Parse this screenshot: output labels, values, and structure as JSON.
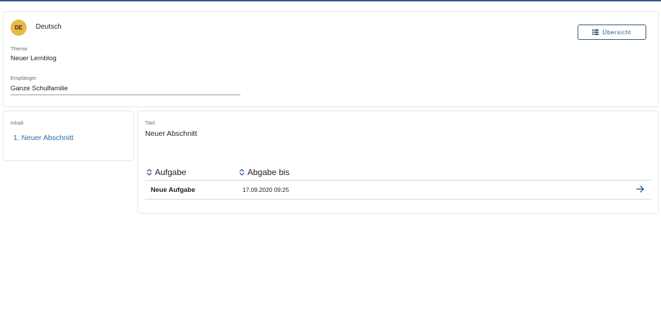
{
  "language": {
    "code": "DE",
    "name": "Deutsch"
  },
  "header_button": {
    "label": "Übersicht",
    "icon": "list-icon"
  },
  "topic": {
    "label": "Thema",
    "value": "Neuer Lernblog"
  },
  "recipient": {
    "label": "Empfänger",
    "value": "Ganze Schulfamilie"
  },
  "sidebar": {
    "label": "Inhalt",
    "items": [
      {
        "label": "1. Neuer Abschnitt"
      }
    ]
  },
  "section": {
    "title_label": "Titel",
    "title_value": "Neuer Abschnitt",
    "table": {
      "columns": [
        {
          "label": "Aufgabe",
          "icon": "sort-icon"
        },
        {
          "label": "Abgabe bis",
          "icon": "sort-icon"
        }
      ],
      "rows": [
        {
          "task": "Neue Aufgabe",
          "due": "17.09.2020 09:25",
          "action_icon": "arrow-right-icon"
        }
      ]
    }
  },
  "colors": {
    "accent": "#2f5a86",
    "link": "#2f6aa3",
    "badge": "#e6b94a"
  }
}
